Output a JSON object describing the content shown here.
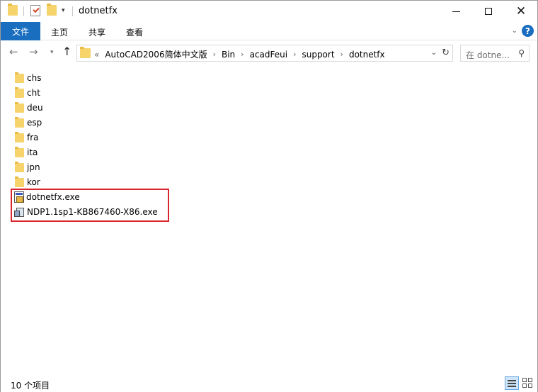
{
  "window": {
    "title": "dotnetfx"
  },
  "title_controls": {
    "minimize": "minimize-icon",
    "maximize": "maximize-icon",
    "close": "close-icon"
  },
  "ribbon": {
    "tabs": [
      {
        "label": "文件",
        "active": true
      },
      {
        "label": "主页"
      },
      {
        "label": "共享"
      },
      {
        "label": "查看"
      }
    ]
  },
  "address": {
    "lead": "«",
    "crumbs": [
      "AutoCAD2006简体中文版",
      "Bin",
      "acadFeui",
      "support",
      "dotnetfx"
    ],
    "separator": "›"
  },
  "search": {
    "placeholder": "在 dotne..."
  },
  "files": [
    {
      "name": "chs",
      "type": "folder"
    },
    {
      "name": "cht",
      "type": "folder"
    },
    {
      "name": "deu",
      "type": "folder"
    },
    {
      "name": "esp",
      "type": "folder"
    },
    {
      "name": "fra",
      "type": "folder"
    },
    {
      "name": "ita",
      "type": "folder"
    },
    {
      "name": "jpn",
      "type": "folder"
    },
    {
      "name": "kor",
      "type": "folder"
    },
    {
      "name": "dotnetfx.exe",
      "type": "exe"
    },
    {
      "name": "NDP1.1sp1-KB867460-X86.exe",
      "type": "installer"
    }
  ],
  "status": {
    "item_count": "10 个项目"
  },
  "colors": {
    "accent": "#1a6ec0",
    "highlight_border": "#d9262e",
    "folder": "#f6d36b"
  }
}
